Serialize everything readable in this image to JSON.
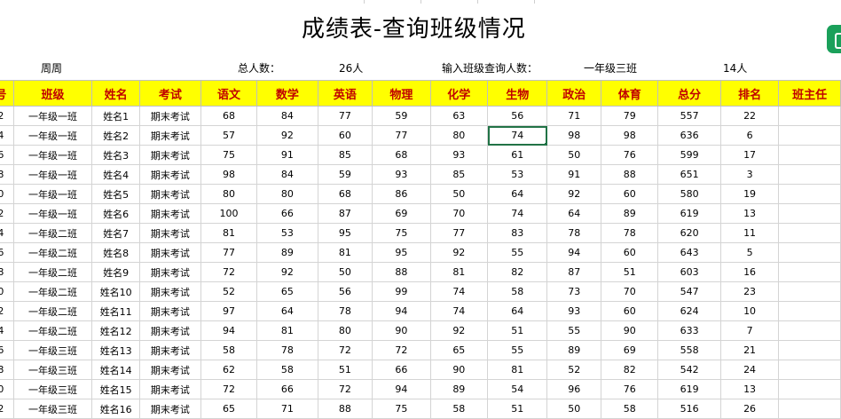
{
  "title": "成绩表-查询班级情况",
  "info": {
    "name": "周周",
    "total_label": "总人数：",
    "total_value": "26人",
    "query_label": "输入班级查询人数：",
    "query_class": "一年级三班",
    "query_count": "14人"
  },
  "headers": [
    "号",
    "班级",
    "姓名",
    "考试",
    "语文",
    "数学",
    "英语",
    "物理",
    "化学",
    "生物",
    "政治",
    "体育",
    "总分",
    "排名",
    "班主任"
  ],
  "rows": [
    [
      "2",
      "一年级一班",
      "姓名1",
      "期末考试",
      "68",
      "84",
      "77",
      "59",
      "63",
      "56",
      "71",
      "79",
      "557",
      "22",
      ""
    ],
    [
      "4",
      "一年级一班",
      "姓名2",
      "期末考试",
      "57",
      "92",
      "60",
      "77",
      "80",
      "74",
      "98",
      "98",
      "636",
      "6",
      ""
    ],
    [
      "6",
      "一年级一班",
      "姓名3",
      "期末考试",
      "75",
      "91",
      "85",
      "68",
      "93",
      "61",
      "50",
      "76",
      "599",
      "17",
      ""
    ],
    [
      "8",
      "一年级一班",
      "姓名4",
      "期末考试",
      "98",
      "84",
      "59",
      "93",
      "85",
      "53",
      "91",
      "88",
      "651",
      "3",
      ""
    ],
    [
      "0",
      "一年级一班",
      "姓名5",
      "期末考试",
      "80",
      "80",
      "68",
      "86",
      "50",
      "64",
      "92",
      "60",
      "580",
      "19",
      ""
    ],
    [
      "2",
      "一年级一班",
      "姓名6",
      "期末考试",
      "100",
      "66",
      "87",
      "69",
      "70",
      "74",
      "64",
      "89",
      "619",
      "13",
      ""
    ],
    [
      "4",
      "一年级二班",
      "姓名7",
      "期末考试",
      "81",
      "53",
      "95",
      "75",
      "77",
      "83",
      "78",
      "78",
      "620",
      "11",
      ""
    ],
    [
      "6",
      "一年级二班",
      "姓名8",
      "期末考试",
      "77",
      "89",
      "81",
      "95",
      "92",
      "55",
      "94",
      "60",
      "643",
      "5",
      ""
    ],
    [
      "8",
      "一年级二班",
      "姓名9",
      "期末考试",
      "72",
      "92",
      "50",
      "88",
      "81",
      "82",
      "87",
      "51",
      "603",
      "16",
      ""
    ],
    [
      "0",
      "一年级二班",
      "姓名10",
      "期末考试",
      "52",
      "65",
      "56",
      "99",
      "74",
      "58",
      "73",
      "70",
      "547",
      "23",
      ""
    ],
    [
      "2",
      "一年级二班",
      "姓名11",
      "期末考试",
      "97",
      "64",
      "78",
      "94",
      "74",
      "64",
      "93",
      "60",
      "624",
      "10",
      ""
    ],
    [
      "4",
      "一年级二班",
      "姓名12",
      "期末考试",
      "94",
      "81",
      "80",
      "90",
      "92",
      "51",
      "55",
      "90",
      "633",
      "7",
      ""
    ],
    [
      "6",
      "一年级三班",
      "姓名13",
      "期末考试",
      "58",
      "78",
      "72",
      "72",
      "65",
      "55",
      "89",
      "69",
      "558",
      "21",
      ""
    ],
    [
      "8",
      "一年级三班",
      "姓名14",
      "期末考试",
      "62",
      "58",
      "51",
      "66",
      "90",
      "81",
      "52",
      "82",
      "542",
      "24",
      ""
    ],
    [
      "0",
      "一年级三班",
      "姓名15",
      "期末考试",
      "72",
      "66",
      "72",
      "94",
      "89",
      "54",
      "96",
      "76",
      "619",
      "13",
      ""
    ],
    [
      "2",
      "一年级三班",
      "姓名16",
      "期末考试",
      "65",
      "71",
      "88",
      "75",
      "58",
      "51",
      "50",
      "58",
      "516",
      "26",
      ""
    ]
  ]
}
